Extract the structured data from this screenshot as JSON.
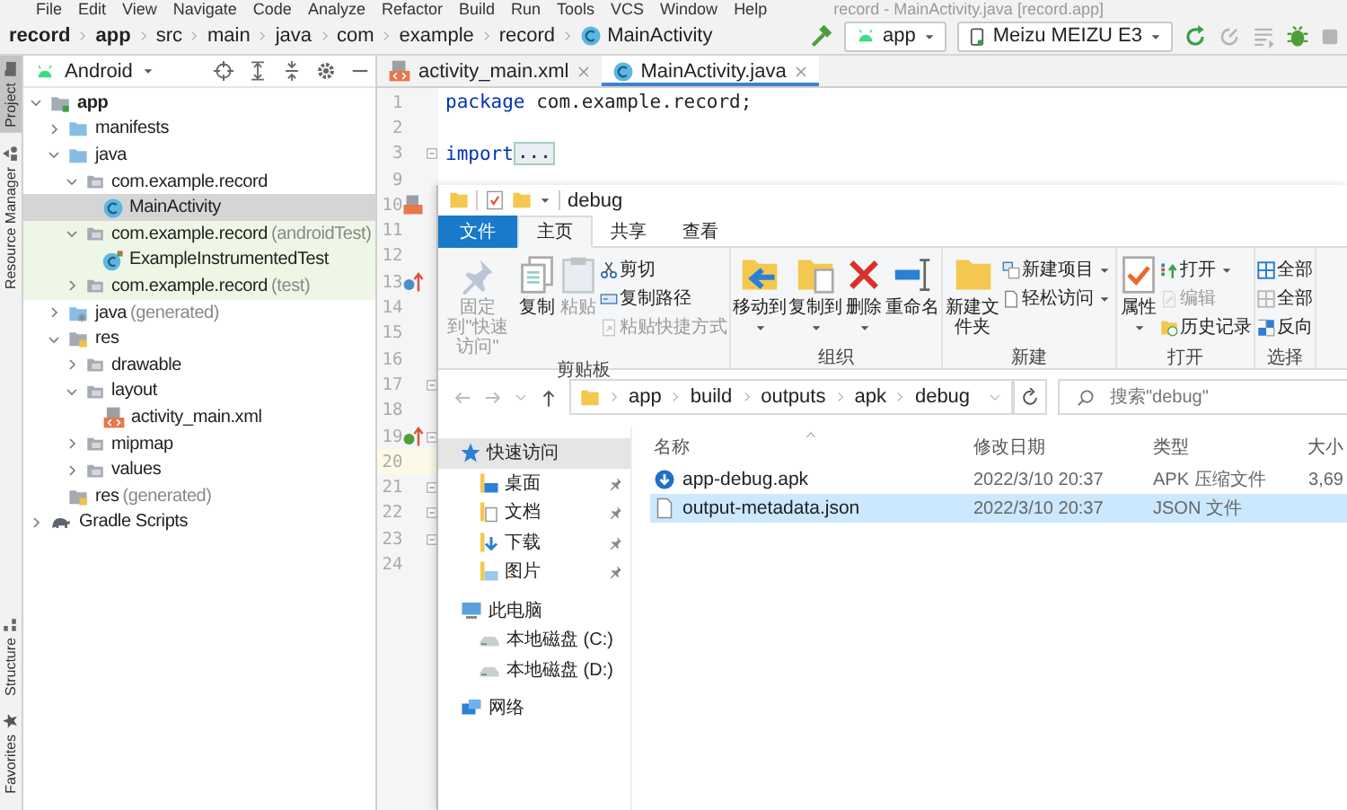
{
  "menu_bar": {
    "items": [
      "File",
      "Edit",
      "View",
      "Navigate",
      "Code",
      "Analyze",
      "Refactor",
      "Build",
      "Run",
      "Tools",
      "VCS",
      "Window",
      "Help"
    ],
    "title": "record - MainActivity.java [record.app]"
  },
  "breadcrumbs": [
    {
      "label": "record",
      "bold": true,
      "kind": "module"
    },
    {
      "label": "app",
      "bold": true,
      "kind": "module"
    },
    {
      "label": "src",
      "bold": false,
      "kind": "folder"
    },
    {
      "label": "main",
      "bold": false,
      "kind": "folder"
    },
    {
      "label": "java",
      "bold": false,
      "kind": "folder"
    },
    {
      "label": "com",
      "bold": false,
      "kind": "folder"
    },
    {
      "label": "example",
      "bold": false,
      "kind": "folder"
    },
    {
      "label": "record",
      "bold": false,
      "kind": "folder"
    },
    {
      "label": "MainActivity",
      "bold": false,
      "kind": "class"
    }
  ],
  "toolbar": {
    "run_config": "app",
    "device": "Meizu MEIZU E3"
  },
  "side_tabs": {
    "top": [
      {
        "label": "Project",
        "selected": true
      },
      {
        "label": "Resource Manager",
        "selected": false
      }
    ],
    "bottom": [
      {
        "label": "Structure",
        "selected": false
      },
      {
        "label": "Favorites",
        "selected": false
      }
    ]
  },
  "project_panel": {
    "view": "Android",
    "tree": [
      {
        "label": "app",
        "kind": "module",
        "expanded": true,
        "children": [
          {
            "label": "manifests",
            "kind": "folder",
            "expanded": false
          },
          {
            "label": "java",
            "kind": "folder",
            "expanded": true,
            "children": [
              {
                "label": "com.example.record",
                "kind": "package",
                "expanded": true,
                "test_source": false,
                "children": [
                  {
                    "label": "MainActivity",
                    "kind": "class",
                    "selected": true
                  }
                ]
              },
              {
                "label": "com.example.record",
                "note": "(androidTest)",
                "kind": "package",
                "expanded": true,
                "test_source": true,
                "children": [
                  {
                    "label": "ExampleInstrumentedTest",
                    "kind": "test-class",
                    "selected": false
                  }
                ]
              },
              {
                "label": "com.example.record",
                "note": "(test)",
                "kind": "package",
                "expanded": false,
                "test_source": true
              }
            ]
          },
          {
            "label": "java",
            "note": "(generated)",
            "kind": "generated",
            "expanded": false
          },
          {
            "label": "res",
            "kind": "res",
            "expanded": true,
            "children": [
              {
                "label": "drawable",
                "kind": "package",
                "expanded": false
              },
              {
                "label": "layout",
                "kind": "package",
                "expanded": true,
                "children": [
                  {
                    "label": "activity_main.xml",
                    "kind": "xml",
                    "selected": false
                  }
                ]
              },
              {
                "label": "mipmap",
                "kind": "package",
                "expanded": false
              },
              {
                "label": "values",
                "kind": "package",
                "expanded": false
              }
            ]
          },
          {
            "label": "res",
            "note": "(generated)",
            "kind": "res",
            "selected": false
          }
        ]
      },
      {
        "label": "Gradle Scripts",
        "kind": "gradle",
        "expanded": false
      }
    ]
  },
  "editor": {
    "tabs": [
      {
        "label": "activity_main.xml",
        "kind": "xml",
        "selected": false
      },
      {
        "label": "MainActivity.java",
        "kind": "class",
        "selected": true
      }
    ],
    "lines": [
      {
        "number": "1",
        "keyword": "package",
        "text": " com.example.record;",
        "current": false,
        "fold": false
      },
      {
        "number": "2",
        "current": false,
        "fold": false
      },
      {
        "number": "3",
        "keyword": "import",
        "folded_text": "...",
        "current": false,
        "fold": true
      },
      {
        "number": "9",
        "current": false,
        "fold": false
      },
      {
        "number": "10",
        "kind": "layout",
        "current": false,
        "fold": false
      },
      {
        "number": "11",
        "current": false,
        "fold": false
      },
      {
        "number": "12",
        "current": false,
        "fold": false
      },
      {
        "number": "13",
        "kind": "override",
        "current": false,
        "fold": false
      },
      {
        "number": "14",
        "current": false,
        "fold": false
      },
      {
        "number": "15",
        "current": false,
        "fold": false
      },
      {
        "number": "16",
        "current": false,
        "fold": false
      },
      {
        "number": "17",
        "current": false,
        "fold": true
      },
      {
        "number": "18",
        "current": false,
        "fold": false
      },
      {
        "number": "19",
        "kind": "implement",
        "current": false,
        "fold": true
      },
      {
        "number": "20",
        "current": true,
        "fold": false
      },
      {
        "number": "21",
        "current": false,
        "fold": true
      },
      {
        "number": "22",
        "current": false,
        "fold": true
      },
      {
        "number": "23",
        "current": false,
        "fold": true
      },
      {
        "number": "24",
        "current": false,
        "fold": false
      }
    ]
  },
  "explorer": {
    "title": "debug",
    "ribbon_tabs": [
      {
        "label": "文件",
        "kind": "file",
        "selected": false
      },
      {
        "label": "主页",
        "kind": "tab",
        "selected": true
      },
      {
        "label": "共享",
        "kind": "tab",
        "selected": false
      },
      {
        "label": "查看",
        "kind": "tab",
        "selected": false
      }
    ],
    "ribbon_groups": [
      {
        "label": "剪贴板",
        "buttons": [
          {
            "label": "固定到\"快速访问\"",
            "kind": "pin",
            "disabled": true,
            "menu": false
          },
          {
            "label": "复制",
            "kind": "copy",
            "disabled": false,
            "menu": false
          },
          {
            "label": "粘贴",
            "kind": "paste",
            "disabled": true,
            "menu": false
          },
          {
            "label": "剪切",
            "kind": "scissors",
            "disabled": false,
            "menu": false
          },
          {
            "label": "复制路径",
            "kind": "path",
            "disabled": false,
            "menu": false
          },
          {
            "label": "粘贴快捷方式",
            "kind": "shortcut",
            "disabled": true,
            "menu": false
          }
        ]
      },
      {
        "label": "组织",
        "buttons": [
          {
            "label": "移动到",
            "kind": "move",
            "disabled": false,
            "menu": true
          },
          {
            "label": "复制到",
            "kind": "copyto",
            "disabled": false,
            "menu": true
          },
          {
            "label": "删除",
            "kind": "delete",
            "disabled": false,
            "menu": true
          },
          {
            "label": "重命名",
            "kind": "rename",
            "disabled": false,
            "menu": false
          }
        ]
      },
      {
        "label": "新建",
        "buttons": [
          {
            "label": "新建文件夹",
            "kind": "newfolder",
            "disabled": false,
            "menu": false
          },
          {
            "label": "新建项目",
            "kind": "newitem",
            "disabled": false,
            "menu": true
          },
          {
            "label": "轻松访问",
            "kind": "easy",
            "disabled": false,
            "menu": true
          }
        ]
      },
      {
        "label": "打开",
        "buttons": [
          {
            "label": "属性",
            "kind": "props",
            "disabled": false,
            "menu": true
          },
          {
            "label": "打开",
            "kind": "open",
            "disabled": false,
            "menu": true
          },
          {
            "label": "编辑",
            "kind": "edit",
            "disabled": true,
            "menu": false
          },
          {
            "label": "历史记录",
            "kind": "history",
            "disabled": false,
            "menu": false
          }
        ]
      },
      {
        "label": "选择",
        "buttons": [
          {
            "label": "全部",
            "kind": "selall",
            "disabled": false,
            "menu": false
          },
          {
            "label": "全部",
            "kind": "selnone",
            "disabled": false,
            "menu": false
          },
          {
            "label": "反向",
            "kind": "invert",
            "disabled": false,
            "menu": false
          }
        ]
      }
    ],
    "path": [
      "app",
      "build",
      "outputs",
      "apk",
      "debug"
    ],
    "search": {
      "placeholder": "搜索\"debug\""
    },
    "nav": [
      {
        "label": "快速访问",
        "kind": "star",
        "selected": true,
        "children": [
          {
            "label": "桌面",
            "kind": "desktop",
            "selected": false,
            "pinned": true
          },
          {
            "label": "文档",
            "kind": "docs",
            "selected": false,
            "pinned": true
          },
          {
            "label": "下载",
            "kind": "download",
            "selected": false,
            "pinned": true
          },
          {
            "label": "图片",
            "kind": "pictures",
            "selected": false,
            "pinned": true
          }
        ]
      },
      {
        "label": "此电脑",
        "kind": "pc",
        "selected": false,
        "children": [
          {
            "label": "本地磁盘 (C:)",
            "kind": "drive",
            "selected": false,
            "pinned": false
          },
          {
            "label": "本地磁盘 (D:)",
            "kind": "drive",
            "selected": false,
            "pinned": false
          }
        ]
      },
      {
        "label": "网络",
        "kind": "network",
        "selected": false
      }
    ],
    "columns": [
      {
        "label": "名称",
        "sorted": true
      },
      {
        "label": "修改日期",
        "sorted": false
      },
      {
        "label": "类型",
        "sorted": false
      },
      {
        "label": "大小",
        "sorted": false
      }
    ],
    "files": [
      {
        "name": "app-debug.apk",
        "kind": "apk",
        "modified": "2022/3/10 20:37",
        "type": "APK 压缩文件",
        "size": "3,69",
        "selected": false
      },
      {
        "name": "output-metadata.json",
        "kind": "file",
        "modified": "2022/3/10 20:37",
        "type": "JSON 文件",
        "selected": true
      }
    ]
  }
}
